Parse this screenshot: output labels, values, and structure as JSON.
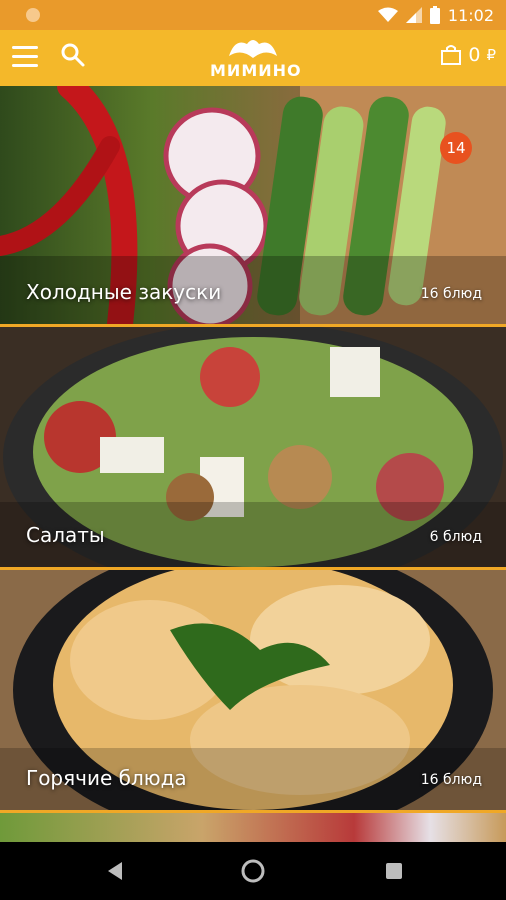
{
  "status_bar": {
    "time": "11:02"
  },
  "app_bar": {
    "logo_text": "МИМИНО",
    "cart_total": "0",
    "currency": "₽"
  },
  "categories": [
    {
      "title": "Холодные закуски",
      "count": "16 блюд",
      "badge": "14"
    },
    {
      "title": "Салаты",
      "count": "6 блюд"
    },
    {
      "title": "Горячие блюда",
      "count": "16 блюд"
    }
  ],
  "colors": {
    "status_bar": "#e99a2b",
    "app_bar": "#f4b82a",
    "separator": "#f0a826",
    "badge": "#e8521f"
  },
  "icons": {
    "menu": "hamburger-menu-icon",
    "search": "search-icon",
    "cart": "shopping-bag-icon",
    "back": "back-triangle-icon",
    "home": "home-circle-icon",
    "recents": "recents-square-icon"
  }
}
